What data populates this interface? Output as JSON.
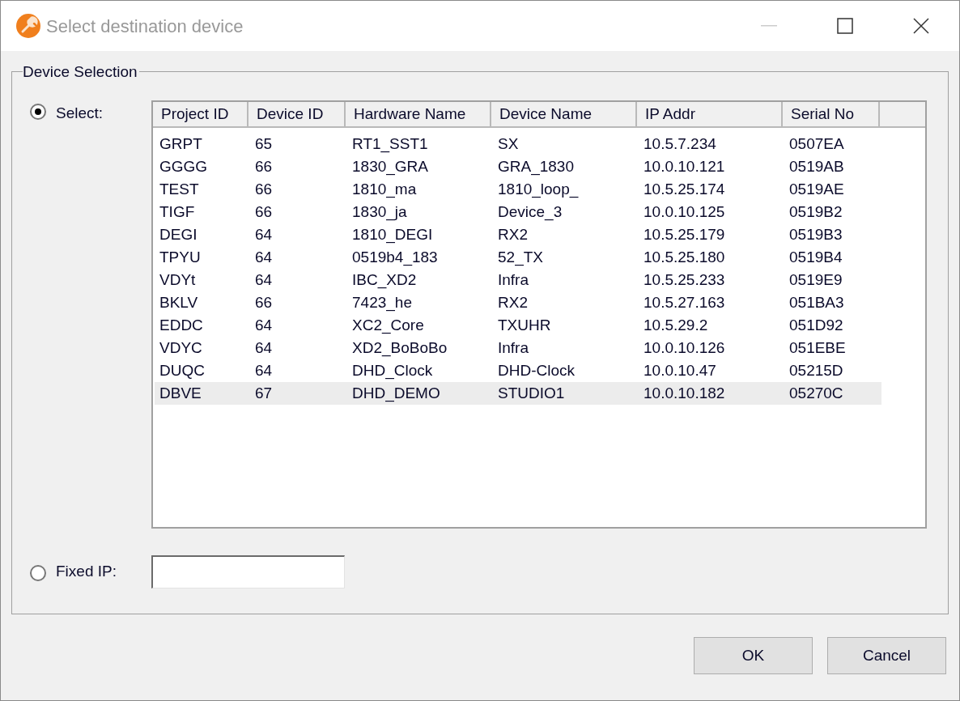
{
  "window": {
    "title": "Select destination device"
  },
  "group": {
    "title": "Device Selection"
  },
  "options": [
    {
      "label": "Select:",
      "selected": true
    },
    {
      "label": "Fixed IP:",
      "selected": false
    }
  ],
  "table": {
    "columns": [
      "Project ID",
      "Device ID",
      "Hardware Name",
      "Device Name",
      "IP Addr",
      "Serial No"
    ],
    "rows": [
      {
        "cells": [
          "GRPT",
          "65",
          "RT1_SST1",
          "SX",
          "10.5.7.234",
          "0507EA"
        ],
        "selected": false
      },
      {
        "cells": [
          "GGGG",
          "66",
          "1830_GRA",
          "GRA_1830",
          "10.0.10.121",
          "0519AB"
        ],
        "selected": false
      },
      {
        "cells": [
          "TEST",
          "66",
          "1810_ma",
          "1810_loop_",
          "10.5.25.174",
          "0519AE"
        ],
        "selected": false
      },
      {
        "cells": [
          "TIGF",
          "66",
          "1830_ja",
          "Device_3",
          "10.0.10.125",
          "0519B2"
        ],
        "selected": false
      },
      {
        "cells": [
          "DEGI",
          "64",
          "1810_DEGI",
          "RX2",
          "10.5.25.179",
          "0519B3"
        ],
        "selected": false
      },
      {
        "cells": [
          "TPYU",
          "64",
          "0519b4_183",
          "52_TX",
          "10.5.25.180",
          "0519B4"
        ],
        "selected": false
      },
      {
        "cells": [
          "VDYt",
          "64",
          "IBC_XD2",
          "Infra",
          "10.5.25.233",
          "0519E9"
        ],
        "selected": false
      },
      {
        "cells": [
          "BKLV",
          "66",
          "7423_he",
          "RX2",
          "10.5.27.163",
          "051BA3"
        ],
        "selected": false
      },
      {
        "cells": [
          "EDDC",
          "64",
          "XC2_Core",
          "TXUHR",
          "10.5.29.2",
          "051D92"
        ],
        "selected": false
      },
      {
        "cells": [
          "VDYC",
          "64",
          "XD2_BoBoBo",
          "Infra",
          "10.0.10.126",
          "051EBE"
        ],
        "selected": false
      },
      {
        "cells": [
          "DUQC",
          "64",
          "DHD_Clock",
          "DHD-Clock",
          "10.0.10.47",
          "05215D"
        ],
        "selected": false
      },
      {
        "cells": [
          "DBVE",
          "67",
          "DHD_DEMO",
          "STUDIO1",
          "10.0.10.182",
          "05270C"
        ],
        "selected": true
      }
    ]
  },
  "buttons": [
    "OK",
    "Cancel"
  ]
}
